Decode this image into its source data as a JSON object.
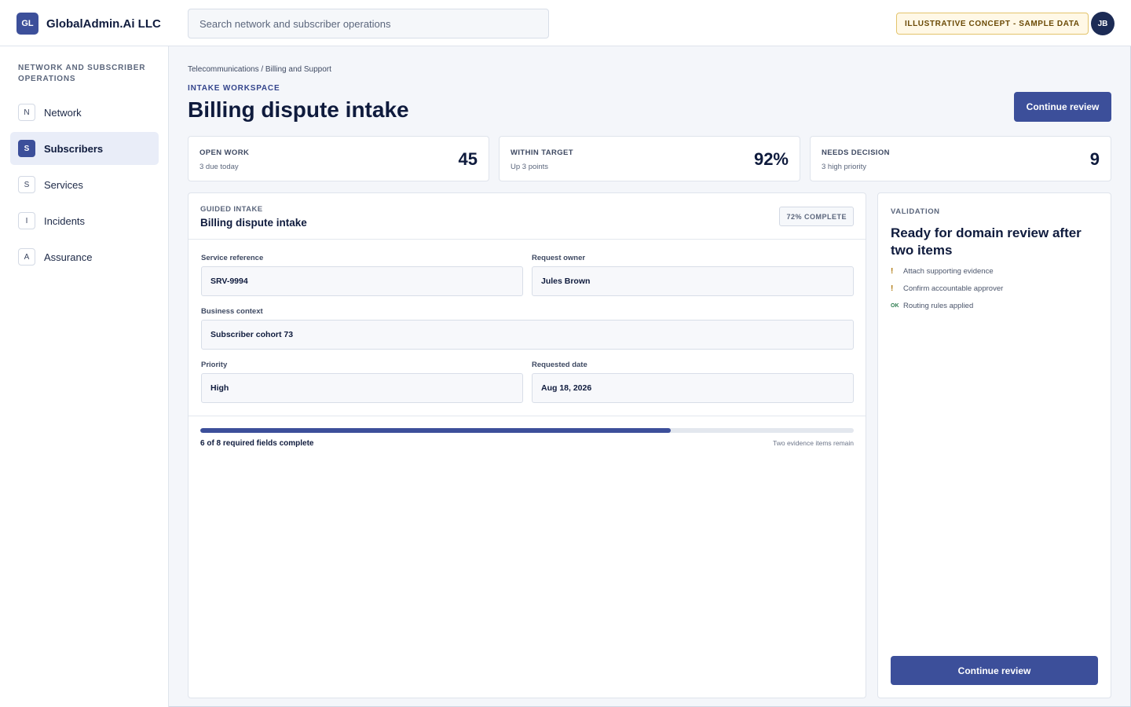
{
  "brand": {
    "logo": "GL",
    "name": "GlobalAdmin.Ai LLC"
  },
  "search": {
    "placeholder": "Search network and subscriber operations"
  },
  "concept_badge": "ILLUSTRATIVE CONCEPT - SAMPLE DATA",
  "user": {
    "initials": "JB"
  },
  "sidebar": {
    "heading": "NETWORK AND SUBSCRIBER OPERATIONS",
    "items": [
      {
        "badge": "N",
        "label": "Network",
        "active": false
      },
      {
        "badge": "S",
        "label": "Subscribers",
        "active": true
      },
      {
        "badge": "S",
        "label": "Services",
        "active": false
      },
      {
        "badge": "I",
        "label": "Incidents",
        "active": false
      },
      {
        "badge": "A",
        "label": "Assurance",
        "active": false
      }
    ]
  },
  "header": {
    "breadcrumb": "Telecommunications / Billing and Support",
    "eyebrow": "INTAKE WORKSPACE",
    "title": "Billing dispute intake",
    "continue_label": "Continue review"
  },
  "stats": [
    {
      "label": "OPEN WORK",
      "sub": "3 due today",
      "value": "45"
    },
    {
      "label": "WITHIN TARGET",
      "sub": "Up 3 points",
      "value": "92%"
    },
    {
      "label": "NEEDS DECISION",
      "sub": "3 high priority",
      "value": "9"
    }
  ],
  "intake": {
    "eyebrow": "GUIDED INTAKE",
    "title": "Billing dispute intake",
    "complete_badge": "72% COMPLETE",
    "fields": {
      "service_reference": {
        "label": "Service reference",
        "value": "SRV-9994"
      },
      "request_owner": {
        "label": "Request owner",
        "value": "Jules Brown"
      },
      "business_context": {
        "label": "Business context",
        "value": "Subscriber cohort 73"
      },
      "priority": {
        "label": "Priority",
        "value": "High"
      },
      "requested_date": {
        "label": "Requested date",
        "value": "Aug 18, 2026"
      }
    },
    "progress": {
      "fraction": 0.72,
      "text": "6 of 8 required fields complete",
      "note": "Two evidence items remain"
    }
  },
  "validation": {
    "eyebrow": "VALIDATION",
    "title": "Ready for domain review after two items",
    "checks": [
      {
        "mark": "!",
        "status": "warning",
        "label": "Attach supporting evidence"
      },
      {
        "mark": "!",
        "status": "warning",
        "label": "Confirm accountable approver"
      },
      {
        "mark": "OK",
        "status": "ok",
        "label": "Routing rules applied"
      }
    ],
    "continue_label": "Continue review"
  },
  "colors": {
    "accent": "#3c4f9a",
    "warning": "#b07a10",
    "ok": "#2e7d4f",
    "badge_bg": "#fff8e6"
  }
}
